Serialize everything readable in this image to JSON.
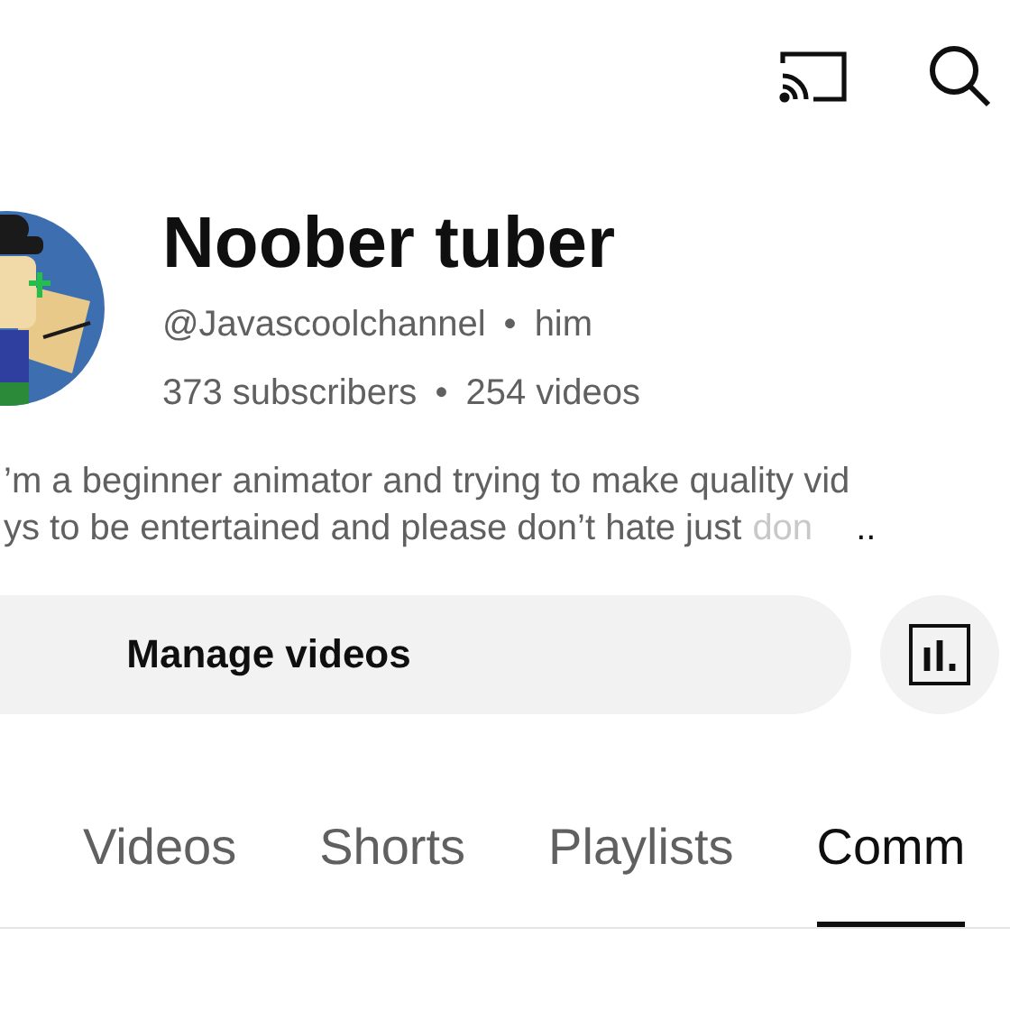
{
  "channel": {
    "name": "Noober tuber",
    "handle": "@Javascoolchannel",
    "pronouns": "him",
    "subscribers": "373 subscribers",
    "videos": "254 videos",
    "separator": "•"
  },
  "description": {
    "lines": [
      "’m a beginner animator and trying to make quality vid",
      "ys to be entertained and please don’t hate just"
    ],
    "faded": "don",
    "more": ".."
  },
  "actions": {
    "manage": "Manage videos"
  },
  "tabs": [
    {
      "label": "Videos",
      "selected": false
    },
    {
      "label": "Shorts",
      "selected": false
    },
    {
      "label": "Playlists",
      "selected": false
    },
    {
      "label": "Comm",
      "selected": true
    }
  ]
}
